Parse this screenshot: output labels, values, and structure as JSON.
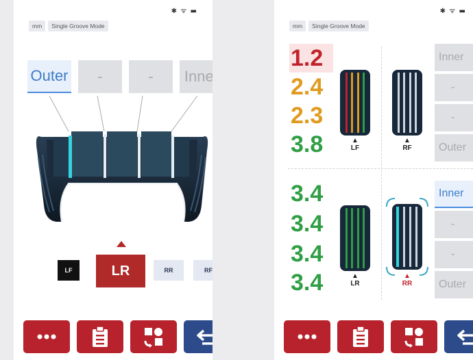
{
  "status_icons": "✱ ᯤ ▬",
  "units_tag": "mm",
  "mode_tag": "Single Groove Mode",
  "screen1": {
    "grooves": [
      {
        "label": "Outer",
        "selected": true
      },
      {
        "label": "-",
        "selected": false
      },
      {
        "label": "-",
        "selected": false
      },
      {
        "label": "Inner",
        "selected": false
      }
    ],
    "positions": {
      "lf": "LF",
      "lr": "LR",
      "rr": "RR",
      "rf": "RF"
    },
    "selected_position": "LR"
  },
  "screen2": {
    "front_values": [
      {
        "value": "1.2",
        "color": "#c0232b"
      },
      {
        "value": "2.4",
        "color": "#e09a1f"
      },
      {
        "value": "2.3",
        "color": "#e09a1f"
      },
      {
        "value": "3.8",
        "color": "#2f9e44"
      }
    ],
    "rear_values": [
      {
        "value": "3.4",
        "color": "#2f9e44"
      },
      {
        "value": "3.4",
        "color": "#2f9e44"
      },
      {
        "value": "3.4",
        "color": "#2f9e44"
      },
      {
        "value": "3.4",
        "color": "#2f9e44"
      }
    ],
    "tire_labels": {
      "lf": "LF",
      "rf": "RF",
      "lr": "LR",
      "rr": "RR"
    },
    "front_side_buttons": [
      "Inner",
      "-",
      "-",
      "Outer"
    ],
    "rear_side_buttons": [
      "Inner",
      "-",
      "-",
      "Outer"
    ]
  },
  "toolbar": {
    "more_icon": "ellipsis-icon",
    "report_icon": "clipboard-icon",
    "rotate_icon": "tire-rotation-icon",
    "back_icon": "back-arrow-icon"
  }
}
